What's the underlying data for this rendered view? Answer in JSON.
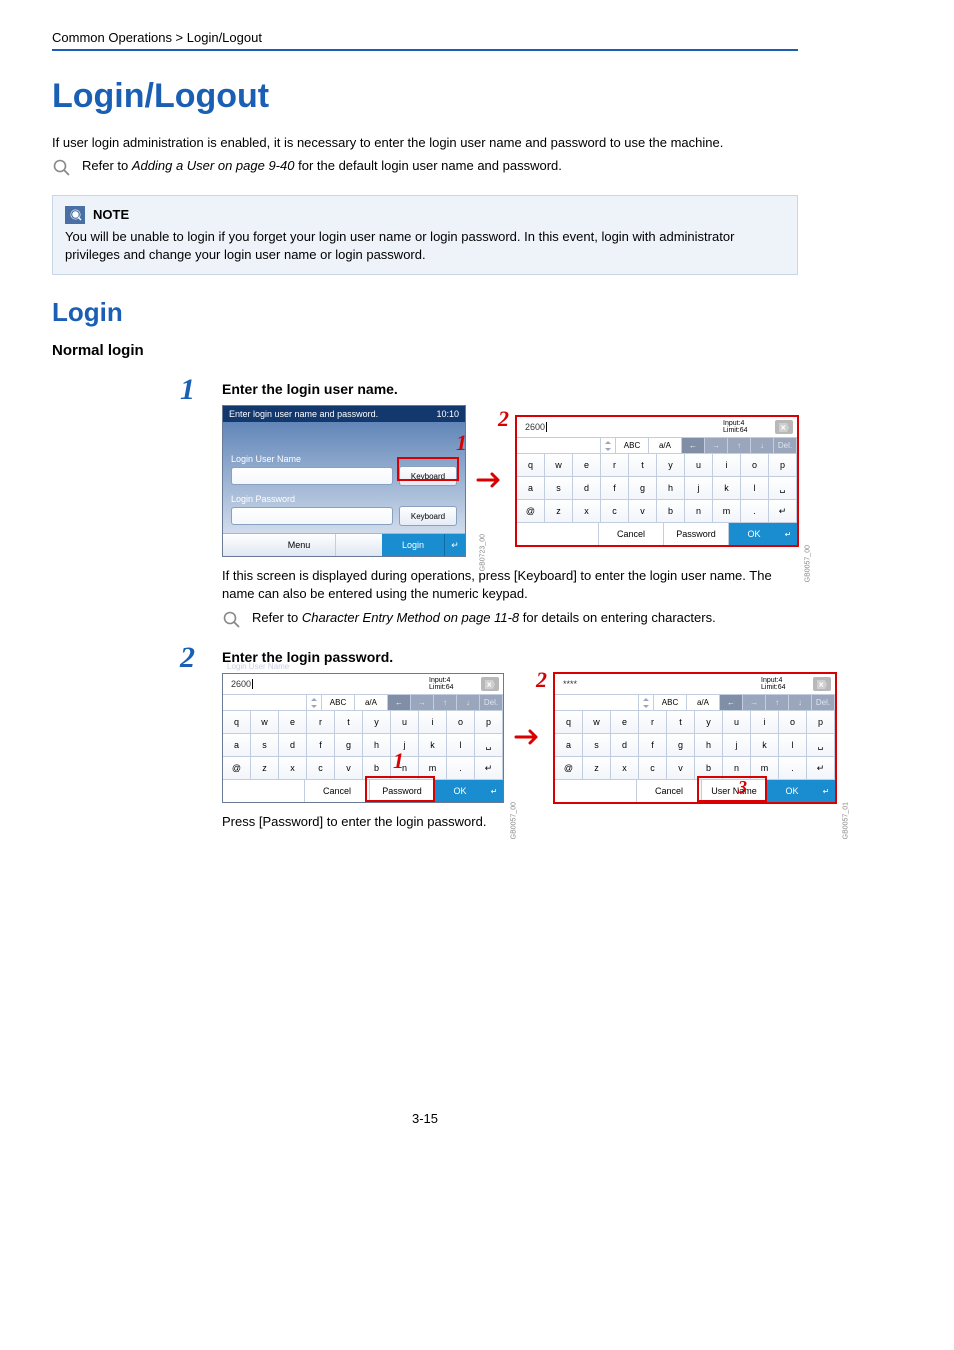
{
  "breadcrumb": "Common Operations > Login/Logout",
  "title": "Login/Logout",
  "intro": "If user login administration is enabled, it is necessary to enter the login user name and password to use the machine.",
  "ref1_prefix": "Refer to ",
  "ref1_link": "Adding a User on page 9-40",
  "ref1_suffix": " for the default login user name and password.",
  "note_label": "NOTE",
  "note_text": "You will be unable to login if you forget your login user name or login password. In this event, login with administrator privileges and change your login user name or login password.",
  "section_login": "Login",
  "subsection_normal": "Normal login",
  "step1": {
    "num": "1",
    "title": "Enter the login user name.",
    "text": "If this screen is displayed during operations, press [Keyboard] to enter the login user name. The name can also be entered using the numeric keypad.",
    "ref_prefix": "Refer to ",
    "ref_link": "Character Entry Method on page 11-8",
    "ref_suffix": " for details on entering characters."
  },
  "step2": {
    "num": "2",
    "title": "Enter the login password.",
    "text": "Press [Password] to enter the login password."
  },
  "login_screen": {
    "header": "Enter login user name and password.",
    "time": "10:10",
    "user_label": "Login User Name",
    "pass_label": "Login Password",
    "keyboard_btn": "Keyboard",
    "menu_btn": "Menu",
    "login_btn": "Login",
    "id": "GB0723_00"
  },
  "kbd": {
    "user_label": "Login User Name",
    "display_user": "2600",
    "display_pass_masked": "****",
    "input_label": "Input:4",
    "limit_label": "Limit:64",
    "abc": "ABC",
    "aA": "a/A",
    "del": "Del.",
    "row1": [
      "q",
      "w",
      "e",
      "r",
      "t",
      "y",
      "u",
      "i",
      "o",
      "p"
    ],
    "row2": [
      "a",
      "s",
      "d",
      "f",
      "g",
      "h",
      "j",
      "k",
      "l"
    ],
    "row3": [
      "@",
      "z",
      "x",
      "c",
      "v",
      "b",
      "n",
      "m",
      "."
    ],
    "cancel": "Cancel",
    "password": "Password",
    "username": "User Name",
    "ok": "OK",
    "id_user_left": "GB0057_00",
    "id_user_right": "GB0057_00",
    "id_pass_right": "GB0057_01"
  },
  "page_number": "3-15"
}
